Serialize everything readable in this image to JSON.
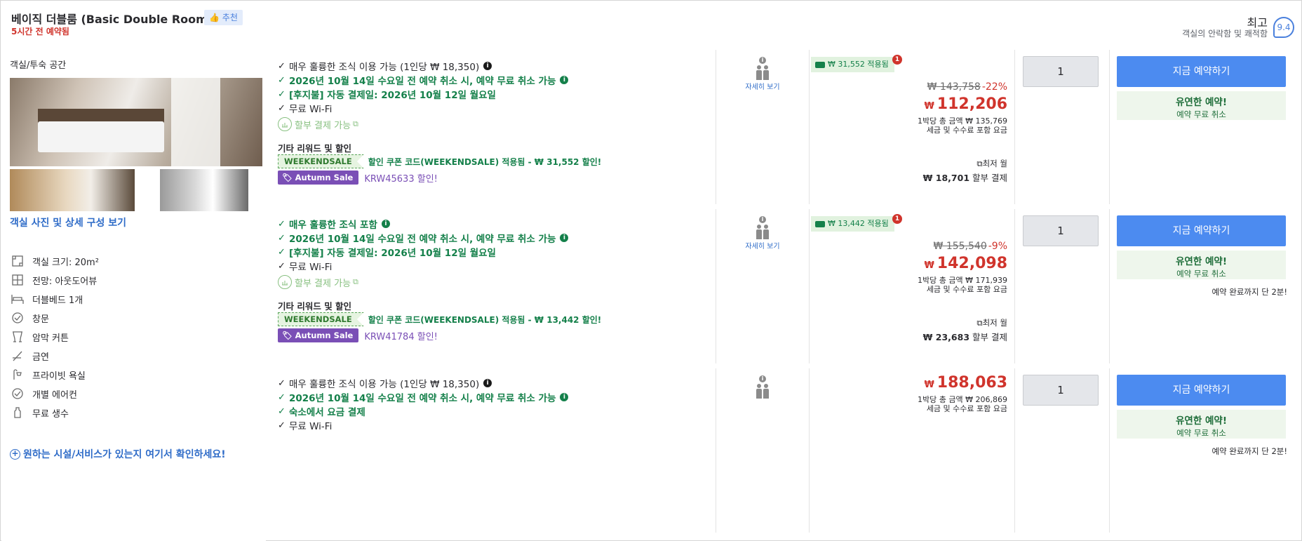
{
  "header": {
    "room_title": "베이직 더블룸 (Basic Double Room)",
    "recommend_label": "추천",
    "booked_text": "5시간 전 예약됨",
    "score_word": "최고",
    "score_sub": "객실의 안락함 및 쾌적함",
    "score_value": "9.4"
  },
  "room": {
    "section_title": "객실/투숙 공간",
    "photo_link": "객실 사진 및 상세 구성 보기",
    "amenities": [
      {
        "icon": "room-size-icon",
        "label": "객실 크기: 20m²"
      },
      {
        "icon": "view-icon",
        "label": "전망: 아웃도어뷰"
      },
      {
        "icon": "bed-icon",
        "label": "더블베드 1개"
      },
      {
        "icon": "window-icon",
        "label": "창문"
      },
      {
        "icon": "curtain-icon",
        "label": "암막 커튼"
      },
      {
        "icon": "no-smoking-icon",
        "label": "금연"
      },
      {
        "icon": "shower-icon",
        "label": "프라이빗 욕실"
      },
      {
        "icon": "aircon-icon",
        "label": "개별 에어컨"
      },
      {
        "icon": "water-icon",
        "label": "무료 생수"
      }
    ],
    "facility_link": "원하는 시설/서비스가 있는지 여기서 확인하세요!"
  },
  "offers": [
    {
      "features": [
        {
          "text": "매우 훌륭한 조식 이용 가능 (1인당 ₩ 18,350)",
          "style": "black",
          "info": "dark"
        },
        {
          "text": "2026년 10월 14일 수요일 전 예약 취소 시, 예약 무료 취소 가능",
          "style": "green",
          "info": "green"
        },
        {
          "text": "[후지불] 자동 결제일: 2026년 10월 12일 월요일",
          "style": "green",
          "info": ""
        },
        {
          "text": "무료 Wi-Fi",
          "style": "black",
          "info": ""
        }
      ],
      "installment_label": "할부 결제 가능",
      "other_title": "기타 리워드 및 할인",
      "coupon_tag": "WEEKENDSALE",
      "coupon_text": "할인 쿠폰 코드(WEEKENDSALE) 적용됨 - ₩ 31,552 할인!",
      "sale_tag": "Autumn Sale",
      "sale_text": "KRW45633 할인!",
      "occupancy_link": "자세히 보기",
      "promo_badge": "₩ 31,552 적용됨",
      "promo_count": "1",
      "original_price": "₩ 143,758",
      "discount_pct": "-22%",
      "currency": "₩",
      "price": "112,206",
      "per_night_total": "1박당 총 금액 ₩ 135,769",
      "tax_note": "세금 및 수수료 포함 요금",
      "min_monthly": "최저 월",
      "installment_amount": "₩ 18,701",
      "installment_suffix": "할부 결제",
      "quantity": "1",
      "book_label": "지금 예약하기",
      "flex_title": "유연한 예약!",
      "flex_sub": "예약 무료 취소",
      "last_minute": ""
    },
    {
      "features": [
        {
          "text": "매우 훌륭한 조식 포함",
          "style": "green",
          "info": "green"
        },
        {
          "text": "2026년 10월 14일 수요일 전 예약 취소 시, 예약 무료 취소 가능",
          "style": "green",
          "info": "green"
        },
        {
          "text": "[후지불] 자동 결제일: 2026년 10월 12일 월요일",
          "style": "green",
          "info": ""
        },
        {
          "text": "무료 Wi-Fi",
          "style": "black",
          "info": ""
        }
      ],
      "installment_label": "할부 결제 가능",
      "other_title": "기타 리워드 및 할인",
      "coupon_tag": "WEEKENDSALE",
      "coupon_text": "할인 쿠폰 코드(WEEKENDSALE) 적용됨 - ₩ 13,442 할인!",
      "sale_tag": "Autumn Sale",
      "sale_text": "KRW41784 할인!",
      "occupancy_link": "자세히 보기",
      "promo_badge": "₩ 13,442 적용됨",
      "promo_count": "1",
      "original_price": "₩ 155,540",
      "discount_pct": "-9%",
      "currency": "₩",
      "price": "142,098",
      "per_night_total": "1박당 총 금액 ₩ 171,939",
      "tax_note": "세금 및 수수료 포함 요금",
      "min_monthly": "최저 월",
      "installment_amount": "₩ 23,683",
      "installment_suffix": "할부 결제",
      "quantity": "1",
      "book_label": "지금 예약하기",
      "flex_title": "유연한 예약!",
      "flex_sub": "예약 무료 취소",
      "last_minute": "예약 완료까지 단 2분!"
    },
    {
      "features": [
        {
          "text": "매우 훌륭한 조식 이용 가능 (1인당 ₩ 18,350)",
          "style": "black",
          "info": "dark"
        },
        {
          "text": "2026년 10월 14일 수요일 전 예약 취소 시, 예약 무료 취소 가능",
          "style": "green",
          "info": "green"
        },
        {
          "text": "숙소에서 요금 결제",
          "style": "green",
          "info": ""
        },
        {
          "text": "무료 Wi-Fi",
          "style": "black",
          "info": ""
        }
      ],
      "currency": "₩",
      "price": "188,063",
      "per_night_total": "1박당 총 금액 ₩ 206,869",
      "tax_note": "세금 및 수수료 포함 요금",
      "quantity": "1",
      "book_label": "지금 예약하기",
      "flex_title": "유연한 예약!",
      "flex_sub": "예약 무료 취소",
      "last_minute": "예약 완료까지 단 2분!"
    }
  ]
}
